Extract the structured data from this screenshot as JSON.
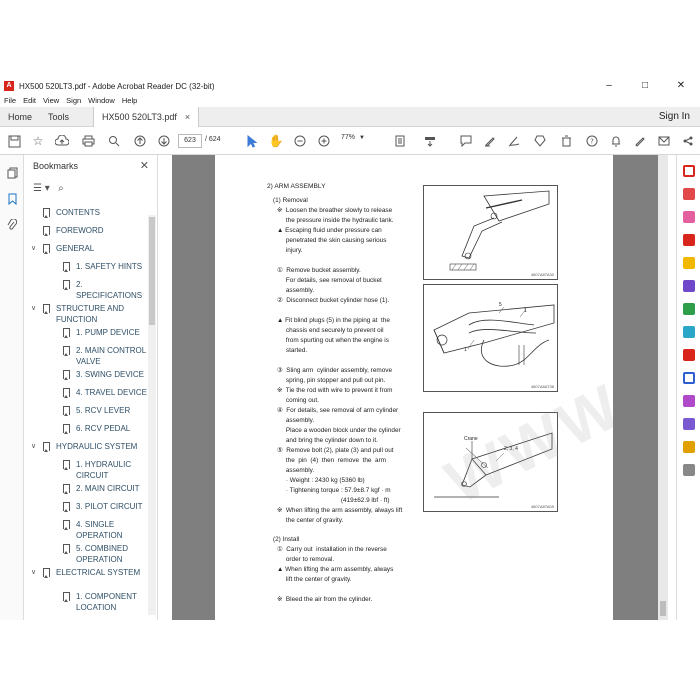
{
  "window": {
    "title": "HX500 520LT3.pdf - Adobe Acrobat Reader DC (32-bit)",
    "controls": [
      "–",
      "□",
      "✕"
    ]
  },
  "menu": [
    "File",
    "Edit",
    "View",
    "Sign",
    "Window",
    "Help"
  ],
  "tabs": {
    "home": "Home",
    "tools": "Tools",
    "document": "HX500 520LT3.pdf",
    "close": "×",
    "sign_in": "Sign In"
  },
  "toolbar": {
    "page_current": "623",
    "page_total": "/ 624",
    "zoom": "77%"
  },
  "bookmarks": {
    "title": "Bookmarks",
    "items": [
      {
        "label": "CONTENTS",
        "level": 0,
        "expandable": false
      },
      {
        "label": "FOREWORD",
        "level": 0,
        "expandable": false
      },
      {
        "label": "GENERAL",
        "level": 0,
        "expandable": true
      },
      {
        "label": "1. SAFETY HINTS",
        "level": 1,
        "expandable": false
      },
      {
        "label": "2. SPECIFICATIONS",
        "level": 1,
        "expandable": false
      },
      {
        "label": "STRUCTURE AND FUNCTION",
        "level": 0,
        "expandable": true
      },
      {
        "label": "1. PUMP DEVICE",
        "level": 1,
        "expandable": false
      },
      {
        "label": "2. MAIN CONTROL VALVE",
        "level": 1,
        "expandable": false
      },
      {
        "label": "3. SWING DEVICE",
        "level": 1,
        "expandable": false
      },
      {
        "label": "4. TRAVEL DEVICE",
        "level": 1,
        "expandable": false
      },
      {
        "label": "5. RCV LEVER",
        "level": 1,
        "expandable": false
      },
      {
        "label": "6. RCV PEDAL",
        "level": 1,
        "expandable": false
      },
      {
        "label": "HYDRAULIC SYSTEM",
        "level": 0,
        "expandable": true
      },
      {
        "label": "1. HYDRAULIC CIRCUIT",
        "level": 1,
        "expandable": false
      },
      {
        "label": "2. MAIN CIRCUIT",
        "level": 1,
        "expandable": false
      },
      {
        "label": "3. PILOT CIRCUIT",
        "level": 1,
        "expandable": false
      },
      {
        "label": "4. SINGLE OPERATION",
        "level": 1,
        "expandable": false
      },
      {
        "label": "5. COMBINED OPERATION",
        "level": 1,
        "expandable": false
      },
      {
        "label": "ELECTRICAL SYSTEM",
        "level": 0,
        "expandable": true
      },
      {
        "label": "1. COMPONENT LOCATION",
        "level": 1,
        "expandable": false
      }
    ]
  },
  "document": {
    "section": "2) ARM ASSEMBLY",
    "removal": {
      "heading": "(1)  Removal",
      "lines": [
        "※  Loosen the breather slowly to release",
        "     the pressure inside the hydraulic tank.",
        "▲ Escaping fluid under pressure can",
        "     penetrated the skin causing serious",
        "     injury.",
        "",
        "①  Remove bucket assembly.",
        "     For details, see removal of bucket",
        "     assembly.",
        "②  Disconnect bucket cylinder hose (1).",
        "",
        "▲ Fit blind plugs (5) in the piping at  the",
        "     chassis end securely to prevent oil",
        "     from spurting out when the engine is",
        "     started.",
        "",
        "③  Sling arm  cylinder assembly, remove",
        "     spring, pin stopper and pull out pin.",
        "※  Tie the rod with wire to prevent it from",
        "     coming out.",
        "④  For details, see removal of arm cylinder",
        "     assembly.",
        "     Place a wooden block under the cylinder",
        "     and bring the cylinder down to it.",
        "⑤  Remove bolt (2), plate (3) and pull out",
        "     the  pin  (4)  then  remove  the  arm",
        "     assembly.",
        "     · Weight : 2430 kg (5360 lb)",
        "     · Tightening torque : 57.9±8.7 kgf · m",
        "                                    (419±62.9 lbf · ft)",
        "※  When lifting the arm assembly, always lift",
        "     the center of gravity."
      ]
    },
    "install": {
      "heading": "(2)  Install",
      "lines": [
        "①  Carry out  installation in the reverse",
        "     order to removal.",
        "▲ When lifting the arm assembly, always",
        "     lift the center of gravity.",
        "",
        "※  Bleed the air from the cylinder."
      ]
    },
    "figures": [
      {
        "code": "4607A8TA30",
        "labels": []
      },
      {
        "code": "4607A8AT36",
        "labels": [
          "5",
          "1",
          "1"
        ]
      },
      {
        "code": "4607A8TA09",
        "labels": [
          "Crane",
          "2, 3, 4"
        ]
      }
    ],
    "watermark": "WWW.EPCATEPO.COM"
  }
}
